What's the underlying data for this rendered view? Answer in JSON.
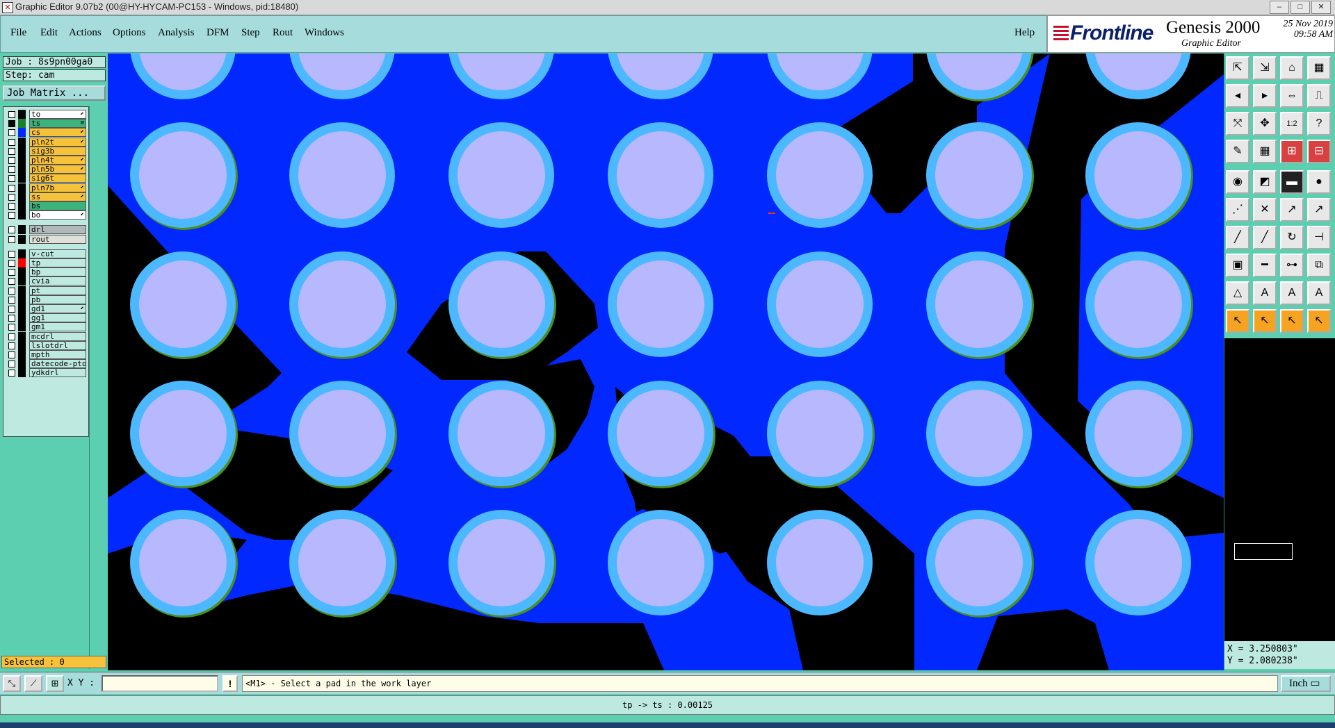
{
  "window": {
    "title": "Graphic Editor 9.07b2 (00@HY-HYCAM-PC153 - Windows, pid:18480)",
    "min_glyph": "–",
    "max_glyph": "□",
    "close_glyph": "✕"
  },
  "menubar": {
    "items": [
      "File",
      "Edit",
      "Actions",
      "Options",
      "Analysis",
      "DFM",
      "Step",
      "Rout",
      "Windows"
    ],
    "help": "Help"
  },
  "logo": {
    "brand": "Frontline",
    "product": "Genesis 2000",
    "subtitle": "Graphic Editor",
    "date": "25 Nov 2019",
    "time": "09:58 AM"
  },
  "job": {
    "job_label": "Job : 8s9pn00ga0",
    "step_label": "Step: cam",
    "matrix_button": "Job Matrix ..."
  },
  "layers": {
    "group1": [
      {
        "name": "to",
        "fill": "#ffffff",
        "swatch": "#000000",
        "mark": "⬋"
      },
      {
        "name": "ts",
        "fill": "#3bb37a",
        "swatch": "#1a7f2a",
        "mark": "≡",
        "checked": true
      },
      {
        "name": "cs",
        "fill": "#f6c23a",
        "swatch": "#0028ff",
        "mark": "⬋"
      },
      {
        "name": "pln2t",
        "fill": "#f6c23a",
        "swatch": "#000000",
        "mark": "⬋"
      },
      {
        "name": "sig3b",
        "fill": "#f6c23a",
        "swatch": "#000000",
        "mark": ""
      },
      {
        "name": "pln4t",
        "fill": "#f6c23a",
        "swatch": "#000000",
        "mark": "⬋"
      },
      {
        "name": "pln5b",
        "fill": "#f6c23a",
        "swatch": "#000000",
        "mark": "⬋"
      },
      {
        "name": "sig6t",
        "fill": "#f6c23a",
        "swatch": "#000000",
        "mark": ""
      },
      {
        "name": "pln7b",
        "fill": "#f6c23a",
        "swatch": "#000000",
        "mark": "⬋"
      },
      {
        "name": "ss",
        "fill": "#f6c23a",
        "swatch": "#000000",
        "mark": "⬋"
      },
      {
        "name": "bs",
        "fill": "#3bb37a",
        "swatch": "#000000",
        "mark": ""
      },
      {
        "name": "bo",
        "fill": "#ffffff",
        "swatch": "#000000",
        "mark": "⬋"
      }
    ],
    "group2": [
      {
        "name": "drl",
        "fill": "#b0b8b8",
        "swatch": "#000000",
        "mark": ""
      },
      {
        "name": "rout",
        "fill": "#e0e0d8",
        "swatch": "#000000",
        "mark": ""
      }
    ],
    "group3": [
      {
        "name": "v-cut",
        "fill": "#bde9e1",
        "swatch": "#000000",
        "mark": ""
      },
      {
        "name": "tp",
        "fill": "#bde9e1",
        "swatch": "#ff0000",
        "mark": ""
      },
      {
        "name": "bp",
        "fill": "#bde9e1",
        "swatch": "#000000",
        "mark": ""
      },
      {
        "name": "cvia",
        "fill": "#bde9e1",
        "swatch": "#000000",
        "mark": ""
      },
      {
        "name": "pt",
        "fill": "#bde9e1",
        "swatch": "#000000",
        "mark": ""
      },
      {
        "name": "pb",
        "fill": "#bde9e1",
        "swatch": "#000000",
        "mark": ""
      },
      {
        "name": "gd1",
        "fill": "#bde9e1",
        "swatch": "#000000",
        "mark": "⬋"
      },
      {
        "name": "gg1",
        "fill": "#bde9e1",
        "swatch": "#000000",
        "mark": ""
      },
      {
        "name": "gm1",
        "fill": "#bde9e1",
        "swatch": "#000000",
        "mark": ""
      },
      {
        "name": "mcdrl",
        "fill": "#bde9e1",
        "swatch": "#000000",
        "mark": ""
      },
      {
        "name": "lslotdrl",
        "fill": "#bde9e1",
        "swatch": "#000000",
        "mark": ""
      },
      {
        "name": "mpth",
        "fill": "#bde9e1",
        "swatch": "#000000",
        "mark": ""
      },
      {
        "name": "datecode-pto",
        "fill": "#bde9e1",
        "swatch": "#000000",
        "mark": ""
      },
      {
        "name": "ydkdrl",
        "fill": "#bde9e1",
        "swatch": "#000000",
        "mark": ""
      }
    ]
  },
  "selected": "Selected : 0",
  "toolbar_icons": [
    "zoom-home-icon",
    "zoom-back-icon",
    "home-icon",
    "split-view-icon",
    "pan-left-icon",
    "pan-right-icon",
    "fit-icon",
    "snap-icon",
    "zoom-fit-icon",
    "zoom-center-icon",
    "scale-1-2-icon",
    "help-icon",
    "measure-icon",
    "grid-icon",
    "feature-filter-icon",
    "feature-select-icon",
    "add-pad-icon",
    "edit-shape-icon",
    "line-pattern-icon",
    "round-pad-icon",
    "connect-icon",
    "move-icon",
    "reshape-icon",
    "arc-icon",
    "line-icon",
    "slash-icon",
    "rotate-icon",
    "mirror-icon",
    "polygon-icon",
    "cut-line-icon",
    "dimension-icon",
    "copy-icon",
    "triangle-icon",
    "surface-a-icon",
    "surface-b-icon",
    "surface-c-icon",
    "pointer-icon",
    "select-pointer-icon",
    "highlight-pointer-icon",
    "multi-pointer-icon"
  ],
  "toolbar_glyphs": [
    "⇱",
    "⇲",
    "⌂",
    "▦",
    "◂",
    "▸",
    "⇔",
    "⎍",
    "⤧",
    "✥",
    "1:2",
    "?",
    "✎",
    "▦",
    "⊞",
    "⊟",
    "◉",
    "◩",
    "▬",
    "●",
    "⋰",
    "✕",
    "↗",
    "↗",
    "╱",
    "╱",
    "↻",
    "⊣",
    "▣",
    "━",
    "⊶",
    "⧉",
    "△",
    "A",
    "A",
    "A",
    "↖",
    "↖",
    "↖",
    "↖"
  ],
  "coords": {
    "x": "X = 3.250803\"",
    "y": "Y = 2.080238\""
  },
  "bottom": {
    "xy_label": "X Y :",
    "xy_value": "",
    "bang": "!",
    "message": "<M1> - Select a pad in the work layer",
    "units": "Inch ▭"
  },
  "status": "tp -> ts : 0.00125",
  "colors": {
    "board": "#0028ff",
    "copper_clear": "#000000",
    "pad_outer": "#4cb8ff",
    "pad_inner": "#b8b8ff",
    "pad_edge": "#4d8f1a"
  }
}
